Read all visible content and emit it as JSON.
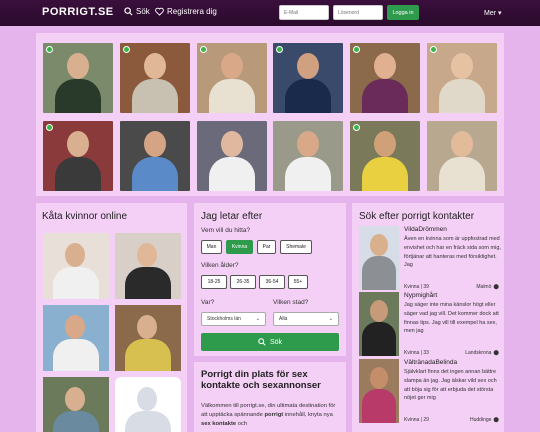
{
  "header": {
    "logo": "PORRIGT.SE",
    "search_label": "Sök",
    "register_label": "Registrera dig",
    "email_placeholder": "E-Mail",
    "password_placeholder": "Lösenord",
    "login_label": "Logga in",
    "more_label": "Mer"
  },
  "colors": {
    "header_bg": "#2a0a2c",
    "page_bg": "#e6b4ec",
    "panel_bg": "#f4cff6",
    "accent_green": "#2e9b4c"
  },
  "left": {
    "title": "Kåta kvinnor online"
  },
  "search": {
    "title": "Jag letar efter",
    "who_label": "Vem vill du hitta?",
    "who_options": [
      "Man",
      "Kvinna",
      "Par",
      "Shemale"
    ],
    "who_selected": "Kvinna",
    "age_label": "Vilken ålder?",
    "age_options": [
      "18-25",
      "26-35",
      "36-54",
      "55+"
    ],
    "where_label": "Var?",
    "where_value": "Stockholms län",
    "city_label": "Vilken stad?",
    "city_value": "Alla",
    "button_label": "Sök"
  },
  "intro": {
    "title": "Porrigt din plats för sex kontakte och sexannonser",
    "text_start": "Välkommen till porrigt.se, din ultimata destination för att upptäcka spännande ",
    "text_bold1": "porrigt",
    "text_mid": " innehåll, knyta nya ",
    "text_bold2": "sex kontakte",
    "text_end": " och"
  },
  "contacts": {
    "title": "Sök efter porrigt kontakter",
    "items": [
      {
        "name": "VildaDrömmen",
        "desc": "Även en kvinna som är uppfostrad med envishet och har en fräck sida som mig, förtjänar att hanteras med försiktighet. Jag",
        "meta": "Kvinna | 39",
        "city": "Malmö"
      },
      {
        "name": "Nypmighårt",
        "desc": "Jag säger inte mina känslor högt eller säger vad jag vill. Det kommer dock att finnas tips. Jag vill till exempel ha sex, men jag",
        "meta": "Kvinna | 33",
        "city": "Landskrona"
      },
      {
        "name": "VältränadaBelinda",
        "desc": "Självklart finns det ingen annan bättre slampa än jag. Jag älskar vild sex och att böja sig för att erbjuda det största nöjet ger mig",
        "meta": "Kvinna | 29",
        "city": "Huddinge"
      }
    ]
  }
}
